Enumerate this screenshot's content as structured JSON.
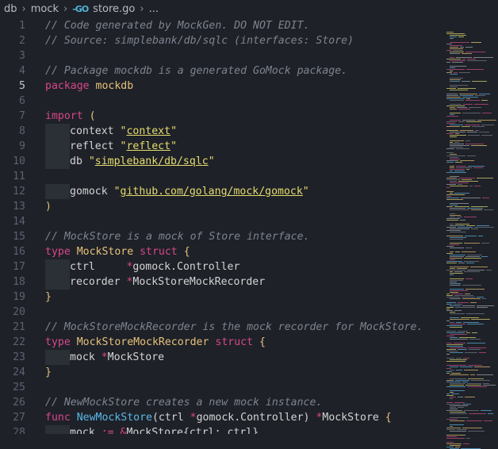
{
  "breadcrumb": {
    "items": [
      "db",
      "mock",
      "store.go",
      "..."
    ],
    "file_icon": "go-icon"
  },
  "editor": {
    "active_line": 5,
    "lines": [
      {
        "n": "1",
        "indent": 0,
        "tokens": [
          {
            "c": "c",
            "t": "// Code generated by MockGen. DO NOT EDIT."
          }
        ]
      },
      {
        "n": "2",
        "indent": 0,
        "tokens": [
          {
            "c": "c",
            "t": "// Source: simplebank/db/sqlc (interfaces: Store)"
          }
        ]
      },
      {
        "n": "3",
        "indent": 0,
        "tokens": []
      },
      {
        "n": "4",
        "indent": 0,
        "tokens": [
          {
            "c": "c",
            "t": "// Package mockdb is a generated GoMock package."
          }
        ]
      },
      {
        "n": "5",
        "indent": 0,
        "tokens": [
          {
            "c": "k",
            "t": "package "
          },
          {
            "c": "t",
            "t": "mockdb"
          }
        ]
      },
      {
        "n": "6",
        "indent": 0,
        "tokens": []
      },
      {
        "n": "7",
        "indent": 0,
        "tokens": [
          {
            "c": "k",
            "t": "import "
          },
          {
            "c": "t",
            "t": "("
          }
        ]
      },
      {
        "n": "8",
        "indent": 1,
        "tokens": [
          {
            "c": "p",
            "t": "context "
          },
          {
            "c": "s",
            "t": "\"context\"",
            "u": true
          }
        ]
      },
      {
        "n": "9",
        "indent": 1,
        "tokens": [
          {
            "c": "p",
            "t": "reflect "
          },
          {
            "c": "s",
            "t": "\"reflect\"",
            "u": true
          }
        ]
      },
      {
        "n": "10",
        "indent": 1,
        "tokens": [
          {
            "c": "p",
            "t": "db "
          },
          {
            "c": "s",
            "t": "\"simplebank/db/sqlc\"",
            "u": true
          }
        ]
      },
      {
        "n": "11",
        "indent": 0,
        "tokens": []
      },
      {
        "n": "12",
        "indent": 1,
        "tokens": [
          {
            "c": "p",
            "t": "gomock "
          },
          {
            "c": "s",
            "t": "\"github.com/golang/mock/gomock\"",
            "u": true
          }
        ]
      },
      {
        "n": "13",
        "indent": 0,
        "tokens": [
          {
            "c": "t",
            "t": ")"
          }
        ]
      },
      {
        "n": "14",
        "indent": 0,
        "tokens": []
      },
      {
        "n": "15",
        "indent": 0,
        "tokens": [
          {
            "c": "c",
            "t": "// MockStore is a mock of Store interface."
          }
        ]
      },
      {
        "n": "16",
        "indent": 0,
        "tokens": [
          {
            "c": "k",
            "t": "type "
          },
          {
            "c": "t",
            "t": "MockStore "
          },
          {
            "c": "k",
            "t": "struct "
          },
          {
            "c": "t",
            "t": "{"
          }
        ]
      },
      {
        "n": "17",
        "indent": 1,
        "tokens": [
          {
            "c": "p",
            "t": "ctrl     "
          },
          {
            "c": "k",
            "t": "*"
          },
          {
            "c": "p",
            "t": "gomock.Controller"
          }
        ]
      },
      {
        "n": "18",
        "indent": 1,
        "tokens": [
          {
            "c": "p",
            "t": "recorder "
          },
          {
            "c": "k",
            "t": "*"
          },
          {
            "c": "p",
            "t": "MockStoreMockRecorder"
          }
        ]
      },
      {
        "n": "19",
        "indent": 0,
        "tokens": [
          {
            "c": "t",
            "t": "}"
          }
        ]
      },
      {
        "n": "20",
        "indent": 0,
        "tokens": []
      },
      {
        "n": "21",
        "indent": 0,
        "tokens": [
          {
            "c": "c",
            "t": "// MockStoreMockRecorder is the mock recorder for MockStore."
          }
        ]
      },
      {
        "n": "22",
        "indent": 0,
        "tokens": [
          {
            "c": "k",
            "t": "type "
          },
          {
            "c": "t",
            "t": "MockStoreMockRecorder "
          },
          {
            "c": "k",
            "t": "struct "
          },
          {
            "c": "t",
            "t": "{"
          }
        ]
      },
      {
        "n": "23",
        "indent": 1,
        "tokens": [
          {
            "c": "p",
            "t": "mock "
          },
          {
            "c": "k",
            "t": "*"
          },
          {
            "c": "p",
            "t": "MockStore"
          }
        ]
      },
      {
        "n": "24",
        "indent": 0,
        "tokens": [
          {
            "c": "t",
            "t": "}"
          }
        ]
      },
      {
        "n": "25",
        "indent": 0,
        "tokens": []
      },
      {
        "n": "26",
        "indent": 0,
        "tokens": [
          {
            "c": "c",
            "t": "// NewMockStore creates a new mock instance."
          }
        ]
      },
      {
        "n": "27",
        "indent": 0,
        "tokens": [
          {
            "c": "k",
            "t": "func "
          },
          {
            "c": "f",
            "t": "NewMockStore"
          },
          {
            "c": "p",
            "t": "(ctrl "
          },
          {
            "c": "k",
            "t": "*"
          },
          {
            "c": "p",
            "t": "gomock.Controller) "
          },
          {
            "c": "k",
            "t": "*"
          },
          {
            "c": "p",
            "t": "MockStore "
          },
          {
            "c": "t",
            "t": "{"
          }
        ]
      },
      {
        "n": "28",
        "indent": 1,
        "tokens": [
          {
            "c": "p",
            "t": "mock "
          },
          {
            "c": "k",
            "t": ":= &"
          },
          {
            "c": "p",
            "t": "MockStore{ctrl: ctrl}"
          }
        ]
      }
    ]
  },
  "colors": {
    "background": "#1e2128",
    "comment": "#7d848f",
    "keyword": "#d8478a",
    "type": "#e6c27a",
    "string": "#e6dc6e",
    "function": "#5bb8e8",
    "line_number": "#5b6270",
    "active_line_number": "#c6c6c6"
  }
}
